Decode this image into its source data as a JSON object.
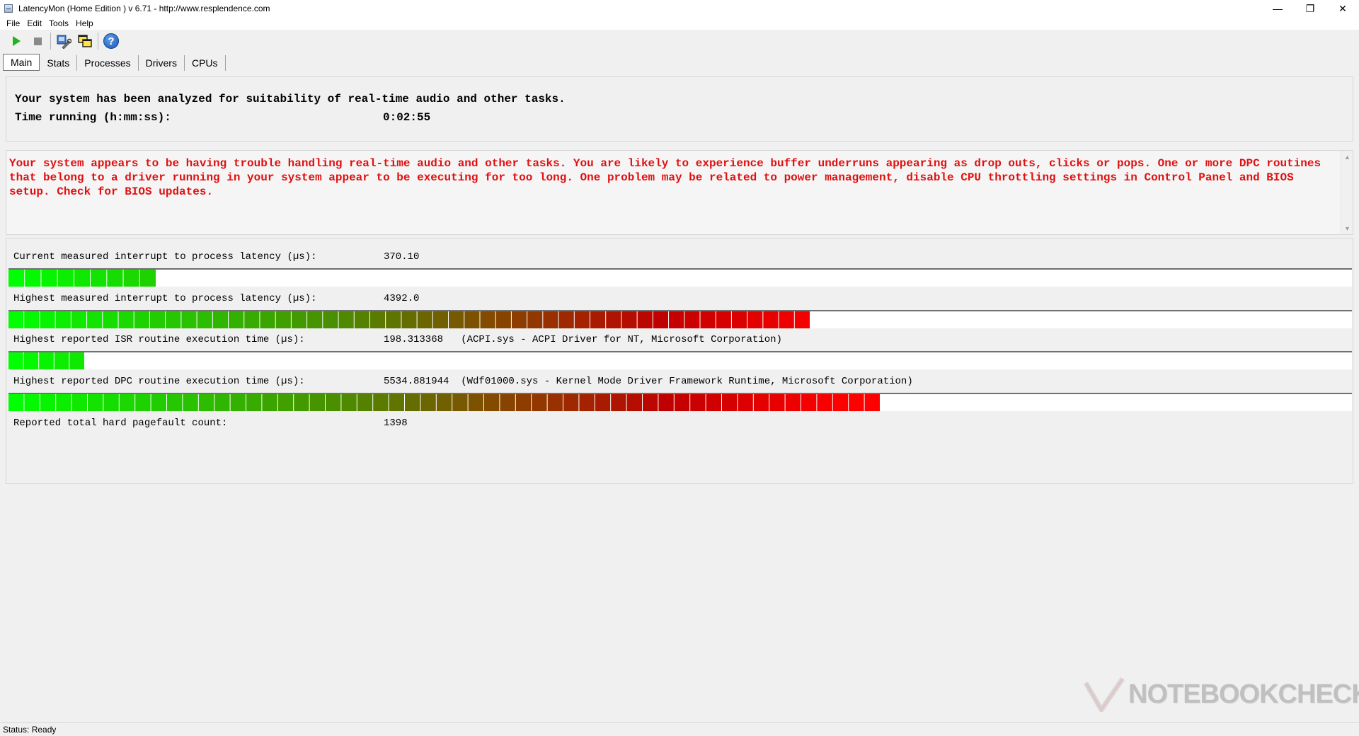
{
  "window": {
    "title": "LatencyMon  (Home Edition )  v 6.71 - http://www.resplendence.com",
    "minimize": "—",
    "restore": "❐",
    "close": "✕"
  },
  "menu": [
    {
      "label": "File"
    },
    {
      "label": "Edit"
    },
    {
      "label": "Tools"
    },
    {
      "label": "Help"
    }
  ],
  "toolbar": {
    "help_glyph": "?"
  },
  "tabs": [
    {
      "label": "Main",
      "active": true
    },
    {
      "label": "Stats",
      "active": false
    },
    {
      "label": "Processes",
      "active": false
    },
    {
      "label": "Drivers",
      "active": false
    },
    {
      "label": "CPUs",
      "active": false
    }
  ],
  "summary": {
    "line1": "Your system has been analyzed for suitability of real-time audio and other tasks.",
    "time_label": "Time running (h:mm:ss):",
    "time_value": "0:02:55"
  },
  "warning": {
    "text": "Your system appears to be having trouble handling real-time audio and other tasks. You are likely to experience buffer underruns appearing as drop outs, clicks or pops. One or more DPC routines that belong to a driver running in your system appear to be executing for too long. One problem may be related to power management, disable CPU throttling settings in Control Panel and BIOS setup. Check for BIOS updates.",
    "color": "#e01010"
  },
  "metrics": [
    {
      "label": "Current measured interrupt to process latency (µs):",
      "value": "370.10",
      "bar_fraction": 0.11
    },
    {
      "label": "Highest measured interrupt to process latency (µs):",
      "value": "4392.0",
      "bar_fraction": 0.597
    },
    {
      "label": "Highest reported ISR routine execution time (µs):",
      "value": "198.313368   (ACPI.sys - ACPI Driver for NT, Microsoft Corporation)",
      "bar_fraction": 0.057
    },
    {
      "label": "Highest reported DPC routine execution time (µs):",
      "value": "5534.881944  (Wdf01000.sys - Kernel Mode Driver Framework Runtime, Microsoft Corporation)",
      "bar_fraction": 0.649
    },
    {
      "label": "Reported total hard pagefault count:",
      "value": "1398",
      "bar_fraction": null
    }
  ],
  "colors": {
    "bar_start": "#00ff00",
    "bar_mid": "#4c8c00",
    "bar_end": "#c00000"
  },
  "status": {
    "text": "Status: Ready"
  },
  "watermark": {
    "text": "NOTEBOOKCHECK"
  }
}
